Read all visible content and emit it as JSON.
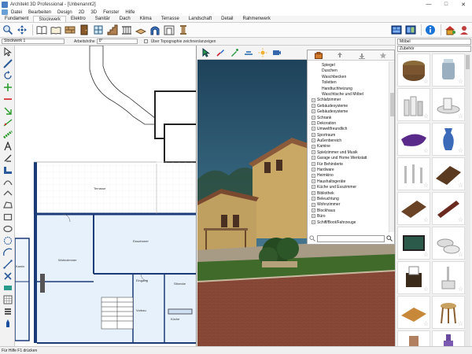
{
  "window": {
    "title": "Architekt 3D Professional - [Unbenannt2]"
  },
  "menu": [
    "Datei",
    "Bearbeiten",
    "Design",
    "2D",
    "3D",
    "Fenster",
    "Hilfe"
  ],
  "tabs": [
    "Fundament",
    "Stockwerk",
    "Elektro",
    "Sanitär",
    "Dach",
    "Klima",
    "Terrasse",
    "Landschaft",
    "Detail",
    "Rahmenwerk"
  ],
  "active_tab": "Stockwerk",
  "propbar": {
    "level_value": "Stockwerk 1",
    "height_label": "Arbeitshöhe",
    "height_value": "0''",
    "topo_label": "Über Topographie zeichnen/anzeigen"
  },
  "plan": {
    "rooms": [
      "Terrasse",
      "Esszimmer",
      "Wohnzimmer",
      "Eingang",
      "Sitzecke",
      "Vorbau",
      "Kamin",
      "Küche"
    ]
  },
  "catalog": {
    "tree": [
      {
        "label": "Spiegel",
        "child": true
      },
      {
        "label": "Duschen",
        "child": true
      },
      {
        "label": "Waschbecken",
        "child": true
      },
      {
        "label": "Toiletten",
        "child": true
      },
      {
        "label": "Handtuchheizung",
        "child": true
      },
      {
        "label": "Waschtische und Möbel",
        "child": true
      },
      {
        "label": "Schlafzimmer",
        "child": false
      },
      {
        "label": "Gebäudesysteme",
        "child": false
      },
      {
        "label": "Gebäudesysteme",
        "child": false
      },
      {
        "label": "Schrank",
        "child": false
      },
      {
        "label": "Dekoration",
        "child": false
      },
      {
        "label": "Umweltfreundlich",
        "child": false
      },
      {
        "label": "Sportraum",
        "child": false
      },
      {
        "label": "Außenbereich",
        "child": false
      },
      {
        "label": "Kamine",
        "child": false
      },
      {
        "label": "Spielzimmer und Musik",
        "child": false
      },
      {
        "label": "Garage und Home Werkstatt",
        "child": false
      },
      {
        "label": "Für Behinderte",
        "child": false
      },
      {
        "label": "Hardware",
        "child": false
      },
      {
        "label": "Heimkino",
        "child": false
      },
      {
        "label": "Haushaltsgeräte",
        "child": false
      },
      {
        "label": "Küche und Esszimmer",
        "child": false
      },
      {
        "label": "Bibliothek",
        "child": false
      },
      {
        "label": "Beleuchtung",
        "child": false
      },
      {
        "label": "Wohnzimmer",
        "child": false
      },
      {
        "label": "Blockhaus",
        "child": false
      },
      {
        "label": "Büro",
        "child": false
      },
      {
        "label": "Schiff/Boot/Fahrzeuge",
        "child": false
      }
    ]
  },
  "rightpanel": {
    "category": "Möbel",
    "subcategory": "Zubehör"
  },
  "status": {
    "text": "Für Hilfe F1 drücken"
  }
}
